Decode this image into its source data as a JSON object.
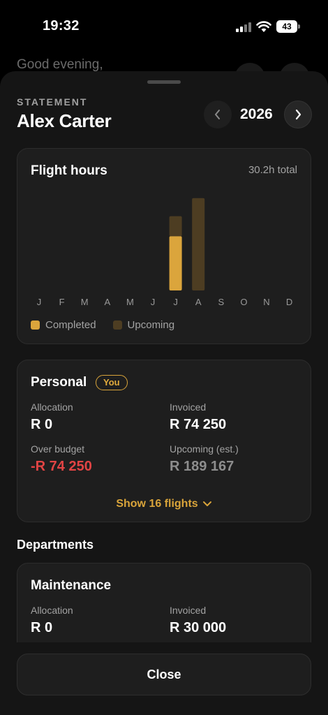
{
  "status": {
    "time": "19:32",
    "battery": "43"
  },
  "background": {
    "greeting": "Good evening,"
  },
  "header": {
    "overline": "STATEMENT",
    "name": "Alex Carter",
    "year": "2026"
  },
  "flight_hours": {
    "title": "Flight hours",
    "total": "30.2h total",
    "legend": {
      "completed": "Completed",
      "upcoming": "Upcoming"
    }
  },
  "chart_data": {
    "type": "bar",
    "categories": [
      "J",
      "F",
      "M",
      "A",
      "M",
      "J",
      "J",
      "A",
      "S",
      "O",
      "N",
      "D"
    ],
    "series": [
      {
        "name": "Completed",
        "values": [
          0,
          0,
          0,
          0,
          0,
          0,
          8.7,
          0,
          0,
          0,
          0,
          0
        ]
      },
      {
        "name": "Upcoming",
        "values": [
          0,
          0,
          0,
          0,
          0,
          0,
          3.2,
          14.8,
          0,
          0,
          0,
          0
        ]
      }
    ],
    "stacked": true,
    "ylim": [
      0,
      16
    ],
    "grid": false,
    "legend_placement": "bottom-left"
  },
  "colors": {
    "completed": "#dba53c",
    "upcoming": "#4d3d22",
    "negative": "#e24444",
    "accent": "#d9a43a"
  },
  "personal": {
    "title": "Personal",
    "badge": "You",
    "allocation_label": "Allocation",
    "allocation_value": "R 0",
    "invoiced_label": "Invoiced",
    "invoiced_value": "R 74 250",
    "over_label": "Over budget",
    "over_value": "-R 74 250",
    "upcoming_label": "Upcoming (est.)",
    "upcoming_value": "R 189 167",
    "show_flights": "Show 16 flights"
  },
  "departments": {
    "title": "Departments",
    "items": [
      {
        "title": "Maintenance",
        "allocation_label": "Allocation",
        "allocation_value": "R 0",
        "invoiced_label": "Invoiced",
        "invoiced_value": "R 30 000"
      }
    ]
  },
  "footer": {
    "close_label": "Close"
  }
}
